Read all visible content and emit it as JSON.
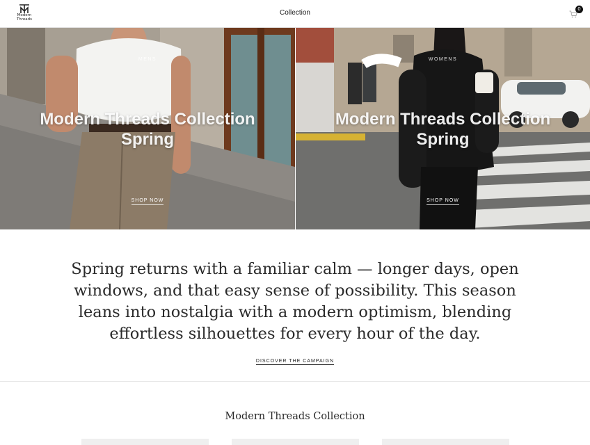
{
  "header": {
    "logo_line1": "Modern",
    "logo_line2": "Threads",
    "nav_title": "Collection",
    "cart_count": "0"
  },
  "hero": {
    "left": {
      "kicker": "MENS",
      "title": "Modern Threads Collection Spring",
      "cta": "SHOP NOW"
    },
    "right": {
      "kicker": "WOMENS",
      "title": "Modern Threads Collection Spring",
      "cta": "SHOP NOW"
    }
  },
  "intro": {
    "text": "Spring returns with a familiar calm — longer days, open windows, and that easy sense of possibility. This season leans into nostalgia with a modern optimism, blending effortless silhouettes for every hour of the day.",
    "link": "DISCOVER THE CAMPAIGN"
  },
  "collection": {
    "heading": "Modern Threads Collection"
  },
  "icons": {
    "logo": "tm-monogram-icon",
    "cart": "shopping-cart-icon"
  }
}
